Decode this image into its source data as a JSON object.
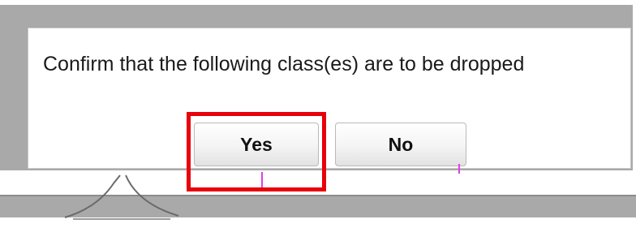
{
  "dialog": {
    "message": "Confirm that the following class(es) are to be dropped",
    "yes_label": "Yes",
    "no_label": "No"
  },
  "colors": {
    "backdrop": "#a9a9a9",
    "highlight": "#e8000b"
  }
}
